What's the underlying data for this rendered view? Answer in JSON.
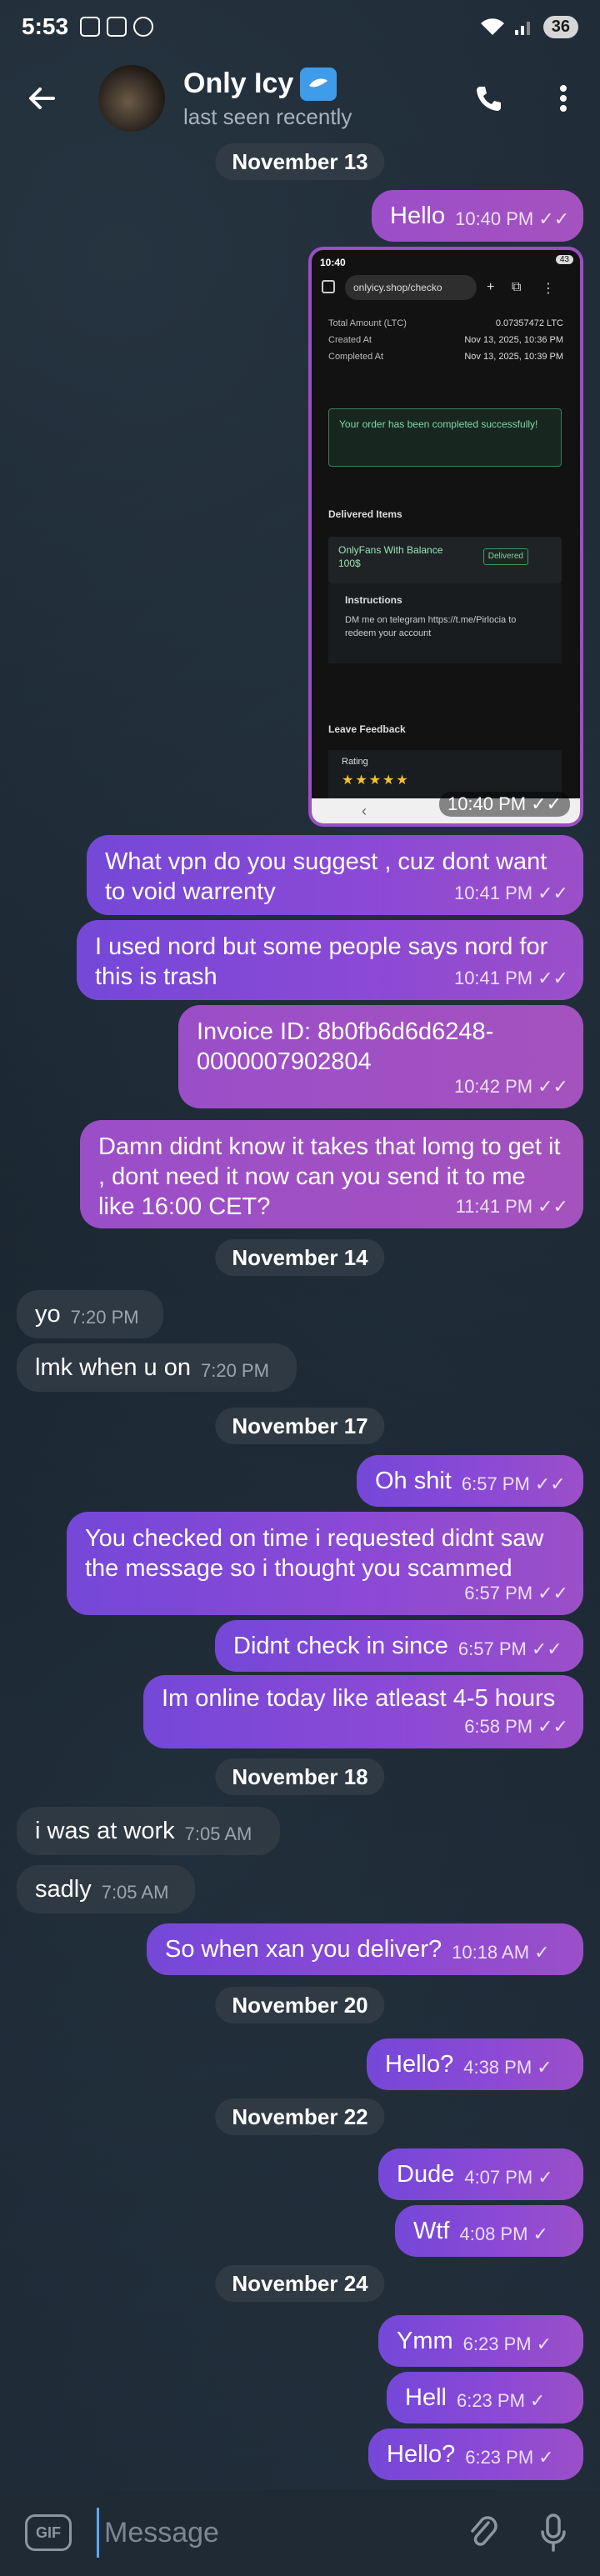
{
  "status_bar": {
    "time": "5:53",
    "battery": "36"
  },
  "header": {
    "title": "Only Icy",
    "subtitle": "last seen recently"
  },
  "messages": [
    {
      "text": "Hello",
      "time": "10:40 PM"
    },
    {
      "text": "What vpn do you suggest , cuz dont want to void warrenty",
      "time": "10:41 PM"
    },
    {
      "text": "I used nord but some people says nord for this is trash",
      "time": "10:41 PM"
    },
    {
      "text": "Invoice ID: 8b0fb6d6d6248-0000007902804",
      "time": "10:42 PM"
    },
    {
      "text": "Damn didnt know it takes that lomg to get it , dont need it now can you send it to me like 16:00 CET?",
      "time": "11:41 PM"
    },
    {
      "text": "yo",
      "time": "7:20 PM"
    },
    {
      "text": "lmk when u on",
      "time": "7:20 PM"
    },
    {
      "text": "Oh shit",
      "time": "6:57 PM"
    },
    {
      "text": "You checked on time i requested didnt saw the message so i thought you scammed",
      "time": "6:57 PM"
    },
    {
      "text": "Didnt check in since",
      "time": "6:57 PM"
    },
    {
      "text": "Im online today like atleast 4-5 hours",
      "time": "6:58 PM"
    },
    {
      "text": "i was at work",
      "time": "7:05 AM"
    },
    {
      "text": "sadly",
      "time": "7:05 AM"
    },
    {
      "text": "So when xan you deliver?",
      "time": "10:18 AM"
    },
    {
      "text": "Hello?",
      "time": "4:38 PM"
    },
    {
      "text": "Dude",
      "time": "4:07 PM"
    },
    {
      "text": "Wtf",
      "time": "4:08 PM"
    },
    {
      "text": "Ymm",
      "time": "6:23 PM"
    },
    {
      "text": "Hell",
      "time": "6:23 PM"
    },
    {
      "text": "Hello?",
      "time": "6:23 PM"
    }
  ],
  "dates": [
    "November 13",
    "November 14",
    "November 17",
    "November 18",
    "November 20",
    "November 22",
    "November 24"
  ],
  "attachment": {
    "time": "10:40 PM",
    "status_time": "10:40",
    "status_battery": "43",
    "url": "onlyicy.shop/checko",
    "rows": [
      {
        "label": "Total Amount (LTC)",
        "value": "0.07357472 LTC"
      },
      {
        "label": "Created At",
        "value": "Nov 13, 2025, 10:36 PM"
      },
      {
        "label": "Completed At",
        "value": "Nov 13, 2025, 10:39 PM"
      }
    ],
    "success_text": "Your order has been completed successfully!",
    "delivered_heading": "Delivered Items",
    "item_name": "OnlyFans With Balance",
    "item_price": "100$",
    "item_badge": "Delivered",
    "instructions_heading": "Instructions",
    "instructions_text": "DM me on telegram https://t.me/Pirlocia to redeem your account",
    "feedback_heading": "Leave Feedback",
    "rating_label": "Rating",
    "stars": "★★★★★"
  },
  "input": {
    "placeholder": "Message",
    "gif_label": "GIF"
  }
}
